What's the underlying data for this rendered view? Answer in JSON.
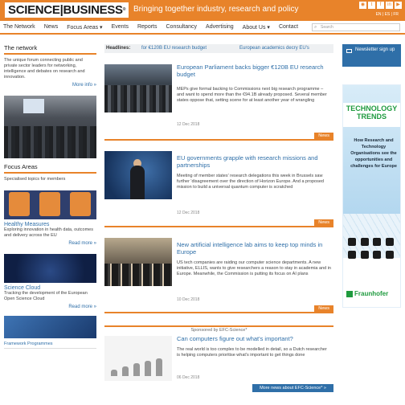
{
  "header": {
    "logo": "SCIENCE|BUSINESS",
    "reg": "®",
    "tagline": "Bringing together industry, research and policy",
    "social_icons": [
      "rss-icon",
      "twitter-icon",
      "facebook-icon",
      "linkedin-icon",
      "youtube-icon"
    ],
    "languages": "EN | ES | FR"
  },
  "nav": {
    "items": [
      "The Network",
      "News",
      "Focus Areas ▾",
      "Events",
      "Reports",
      "Consultancy",
      "Advertising",
      "About Us ▾",
      "Contact"
    ],
    "search_placeholder": "Search"
  },
  "left": {
    "network_title": "The network",
    "network_text": "The unique forum connecting public and private sector leaders for networking, intelligence and debates on research and innovation.",
    "more_info": "More info »",
    "focus_title": "Focus Areas",
    "focus_text": "Specialised topics for members",
    "healthy_title": "Healthy Measures",
    "healthy_text": "Exploring innovation in health data, outcomes and delivery across the EU",
    "read_more": "Read more »",
    "cloud_title": "Science Cloud",
    "cloud_text": "Tracking the development of the European Open Science Cloud",
    "cloud_read_more": "Read more »",
    "framework_label": "Framework Programmes"
  },
  "ticker": {
    "label": "Headlines:",
    "items": [
      "for €120B EU research budget",
      "European academics decry EU's"
    ]
  },
  "articles": [
    {
      "title": "European Parliament backs bigger €120B EU research budget",
      "body": "MEPs give formal backing to Commissions next big research programme – and want to spend more than the €94.1B already proposed. Several member states oppose that, setting scene for at least another year of wrangling",
      "date": "12 Dec 2018",
      "tag": "News"
    },
    {
      "title": "EU governments grapple with research missions and partnerships",
      "body": "Meeting of member states' research delegations this week in Brussels saw further 'disagreement over the direction of Horizon Europe. And a proposed mission to build a universal quantum computer is scratched",
      "date": "12 Dec 2018",
      "tag": "News"
    },
    {
      "title": "New artificial intelligence lab aims to keep top minds in Europe",
      "body": "US tech companies are raiding our computer science departments. A new initiative, ELLIS, wants to give researchers a reason to stay in academia and in Europe. Meanwhile, the Commission is putting its focus on AI plans",
      "date": "10 Dec 2018",
      "tag": "News"
    },
    {
      "sponsor": "Sponsored by EFC-Science*",
      "title": "Can computers figure out what's important?",
      "body": "The real world is too complex to be modelled in detail, so a Dutch researcher is helping computers prioritise what's important to get things done",
      "date": "06 Dec 2018",
      "more_button": "More news about EFC-Science* »"
    }
  ],
  "right": {
    "newsletter": "Newsletter sign up",
    "ad_title": "TECHNOLOGY TRENDS",
    "ad_text": "How Research and Technology Organisations see the opportunities and challenges for Europe",
    "ad_brand": "Fraunhofer"
  },
  "colors": {
    "accent": "#e8832a",
    "link": "#2f6fa8",
    "brand_green": "#1e9a3e"
  }
}
